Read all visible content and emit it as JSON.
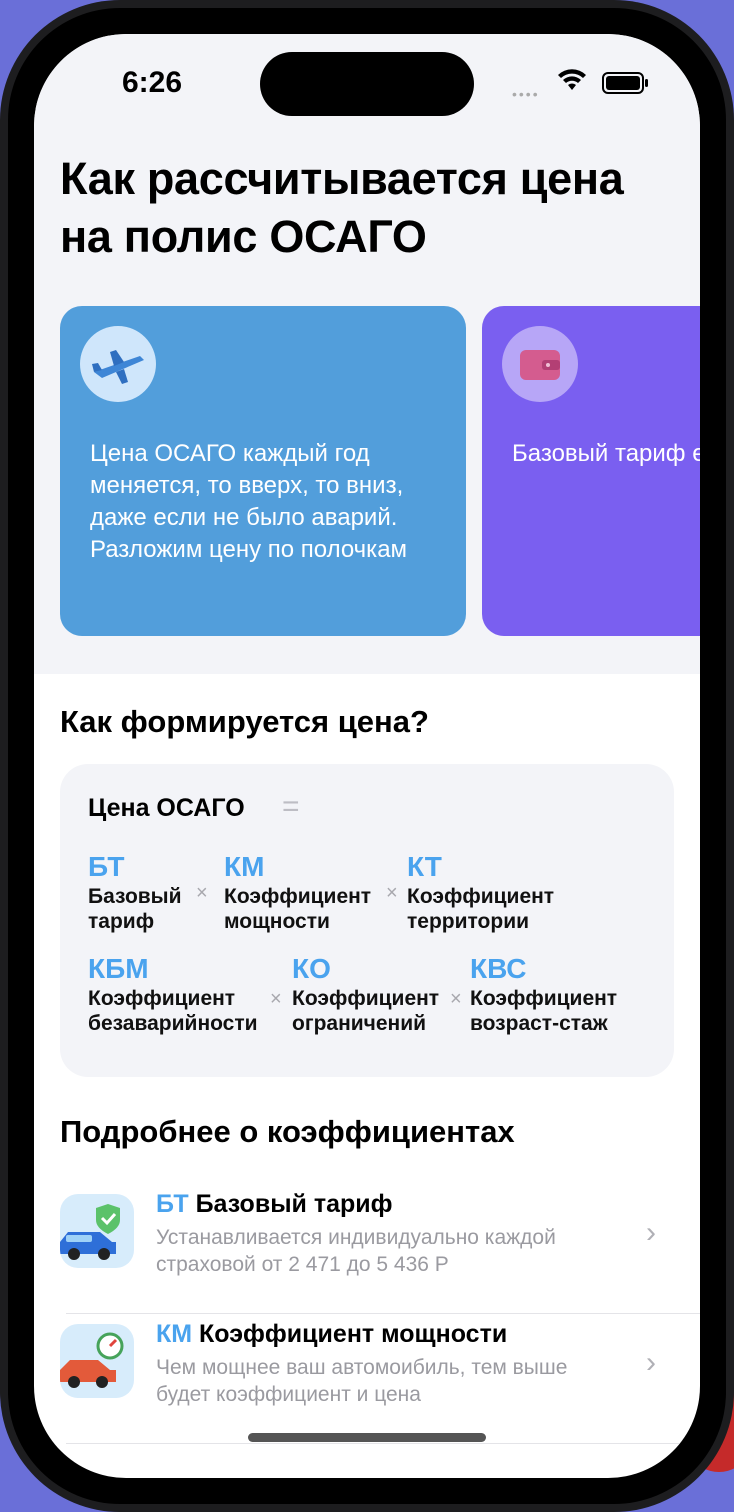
{
  "status": {
    "time": "6:26"
  },
  "header": {
    "title": "Как рассчитывается цена на полис ОСАГО"
  },
  "cards": [
    {
      "text": "Цена ОСАГО каждый год меняется, то вверх, то вниз, даже если не было аварий. Разложим цену по полочкам",
      "icon": "airplane-icon"
    },
    {
      "text": "Базовый тариф единственный п который индиви устанавливаетс компанией, все параметры един",
      "icon": "wallet-icon"
    }
  ],
  "formation": {
    "title": "Как формируется цена?",
    "head": "Цена ОСАГО",
    "equals": "=",
    "times": "×",
    "terms": [
      {
        "code": "БТ",
        "name1": "Базовый",
        "name2": "тариф"
      },
      {
        "code": "КМ",
        "name1": "Коэффициент",
        "name2": "мощности"
      },
      {
        "code": "КТ",
        "name1": "Коэффициент",
        "name2": "территории"
      },
      {
        "code": "КБМ",
        "name1": "Коэффициент",
        "name2": "безаварийности"
      },
      {
        "code": "КО",
        "name1": "Коэффициент",
        "name2": "ограничений"
      },
      {
        "code": "КВС",
        "name1": "Коэффициент",
        "name2": "возраст-стаж"
      }
    ]
  },
  "details": {
    "title": "Подробнее о коэффициентах",
    "items": [
      {
        "code": "БТ",
        "label": "Базовый тариф",
        "sub": "Устанавливается индивидуально каждой страховой от 2 471 до 5 436 Р",
        "icon": "car-shield-icon"
      },
      {
        "code": "КМ",
        "label": "Коэффициент мощности",
        "sub": "Чем мощнее ваш автомоибиль, тем выше будет коэффициент и цена",
        "icon": "car-speedometer-icon"
      }
    ]
  }
}
